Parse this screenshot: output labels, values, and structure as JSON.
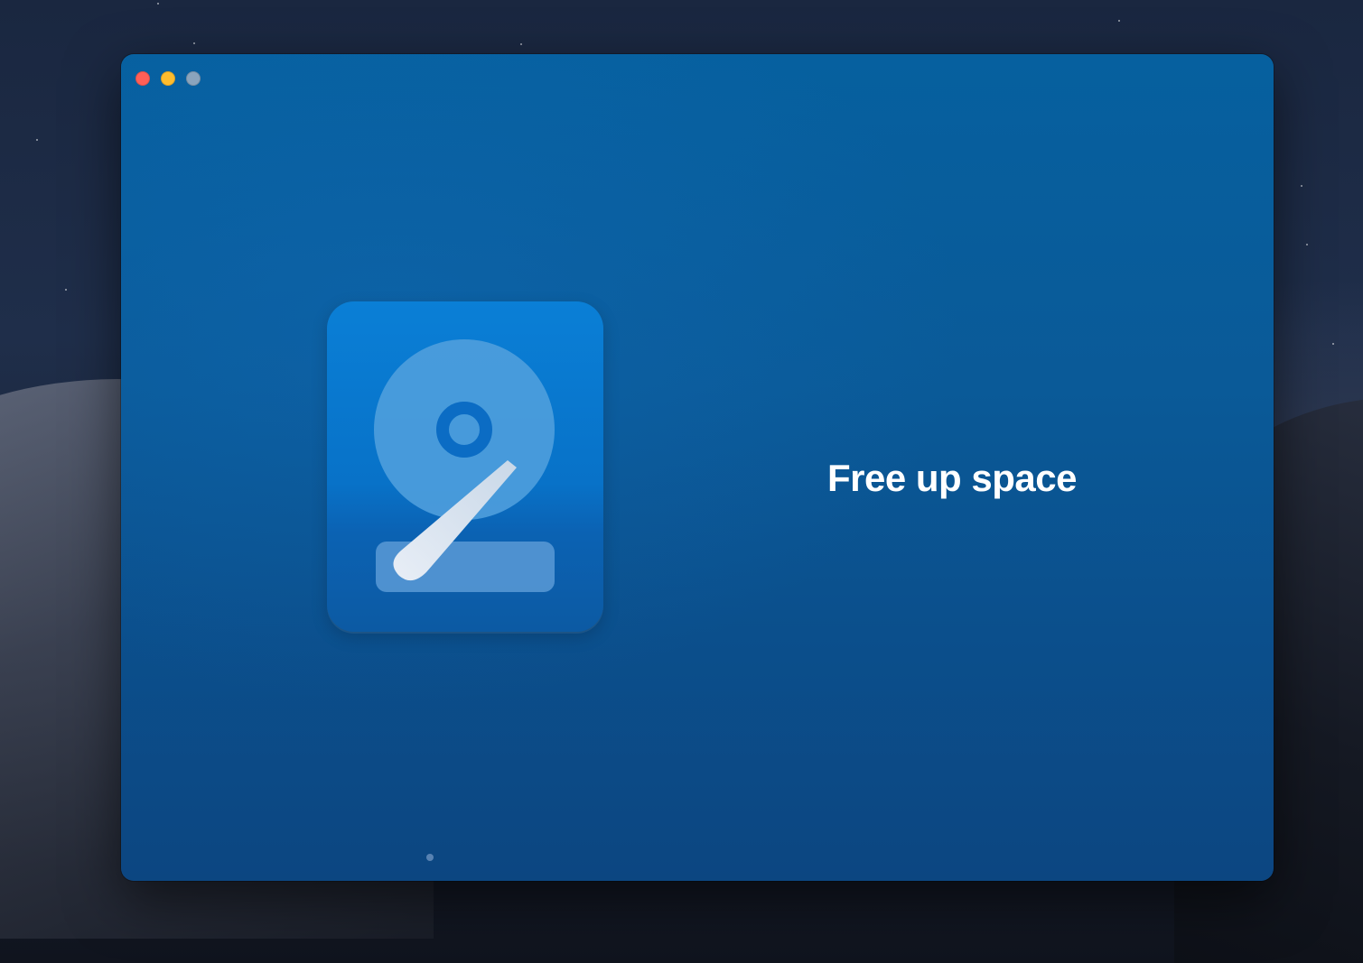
{
  "window": {
    "controls": [
      {
        "name": "close",
        "color": "#ff5f57"
      },
      {
        "name": "minimize",
        "color": "#febc2e"
      },
      {
        "name": "zoom",
        "color": "#8aa4bd"
      }
    ]
  },
  "onboarding": {
    "icon": "hard-drive-icon",
    "headline": "Free up space"
  },
  "colors": {
    "window_bg": "#0a5a98",
    "icon_bg": "#0872c8",
    "headline_text": "#ffffff"
  }
}
